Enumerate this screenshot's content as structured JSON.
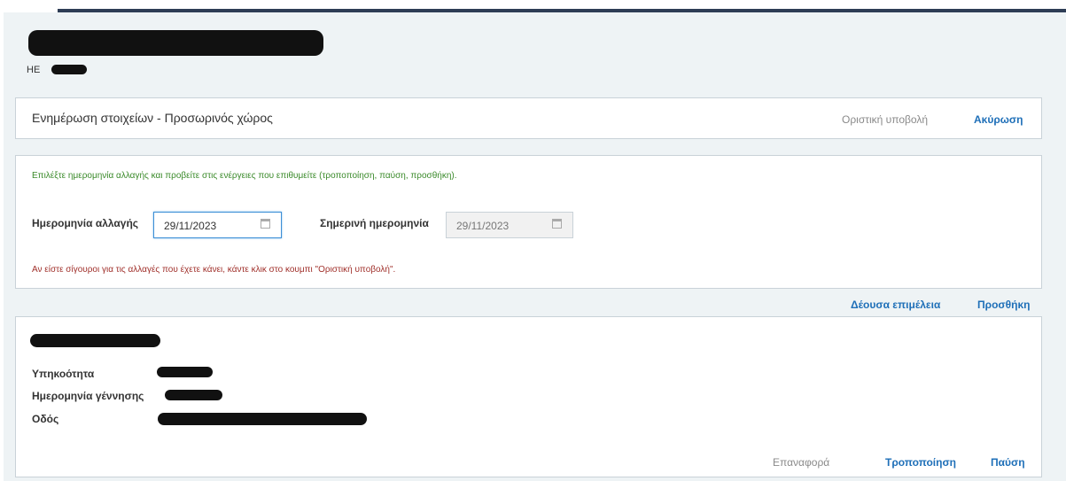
{
  "header": {
    "subtitle_prefix": "HE"
  },
  "toolbar": {
    "title": "Ενημέρωση στοιχείων - Προσωρινός χώρος",
    "submit_label": "Οριστική υποβολή",
    "cancel_label": "Ακύρωση"
  },
  "dates": {
    "hint": "Επιλέξτε ημερομηνία αλλαγής και προβείτε στις ενέργειες που επιθυμείτε (τροποποίηση, παύση, προσθήκη).",
    "change_label": "Ημερομηνία αλλαγής",
    "change_value": "29/11/2023",
    "today_label": "Σημερινή ημερομηνία",
    "today_value": "29/11/2023",
    "warning": "Αν είστε σίγουροι για τις αλλαγές που έχετε κάνει, κάντε κλικ στο κουμπι \"Οριστική υποβολή\"."
  },
  "actions": {
    "due_diligence": "Δέουσα επιμέλεια",
    "add": "Προσθήκη"
  },
  "record": {
    "fields": [
      "Υπηκοότητα",
      "Ημερομηνία γέννησης",
      "Οδός"
    ],
    "restore": "Επαναφορά",
    "modify": "Τροποποίηση",
    "pause": "Παύση"
  },
  "colors": {
    "link": "#1e6fb8",
    "hint": "#3a8a2a",
    "warning": "#a0302b",
    "background": "#eef3f5"
  }
}
